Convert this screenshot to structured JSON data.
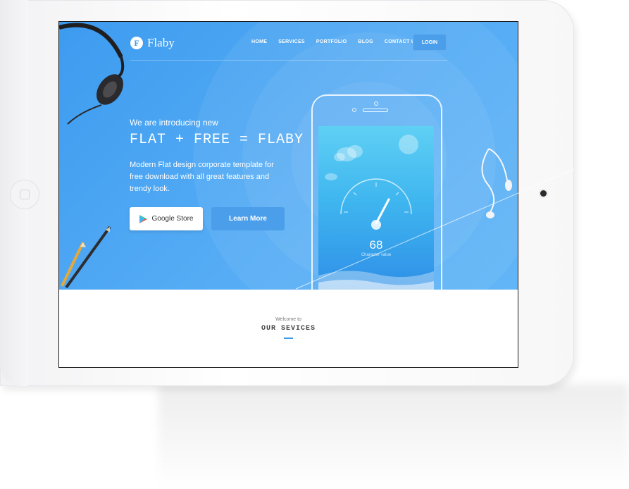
{
  "brand": {
    "logo_letter": "F",
    "name": "Flaby"
  },
  "nav": {
    "items": [
      "HOME",
      "SERVICES",
      "PORTFOLIO",
      "BLOG",
      "CONTACT US"
    ],
    "login_label": "LOGIN"
  },
  "hero": {
    "intro": "We are introducing new",
    "headline": "FLAT + FREE = FLABY",
    "description": "Modern Flat design corporate template for free download with all great features and trendy look.",
    "store_button": "Google Store",
    "learn_button": "Learn More"
  },
  "phone_app": {
    "gauge_value": "68",
    "gauge_label": "Character value"
  },
  "services": {
    "welcome": "Welcome to",
    "title": "OUR SEVICES"
  },
  "colors": {
    "accent": "#3d9bef",
    "button_blue": "#4a9eea"
  }
}
